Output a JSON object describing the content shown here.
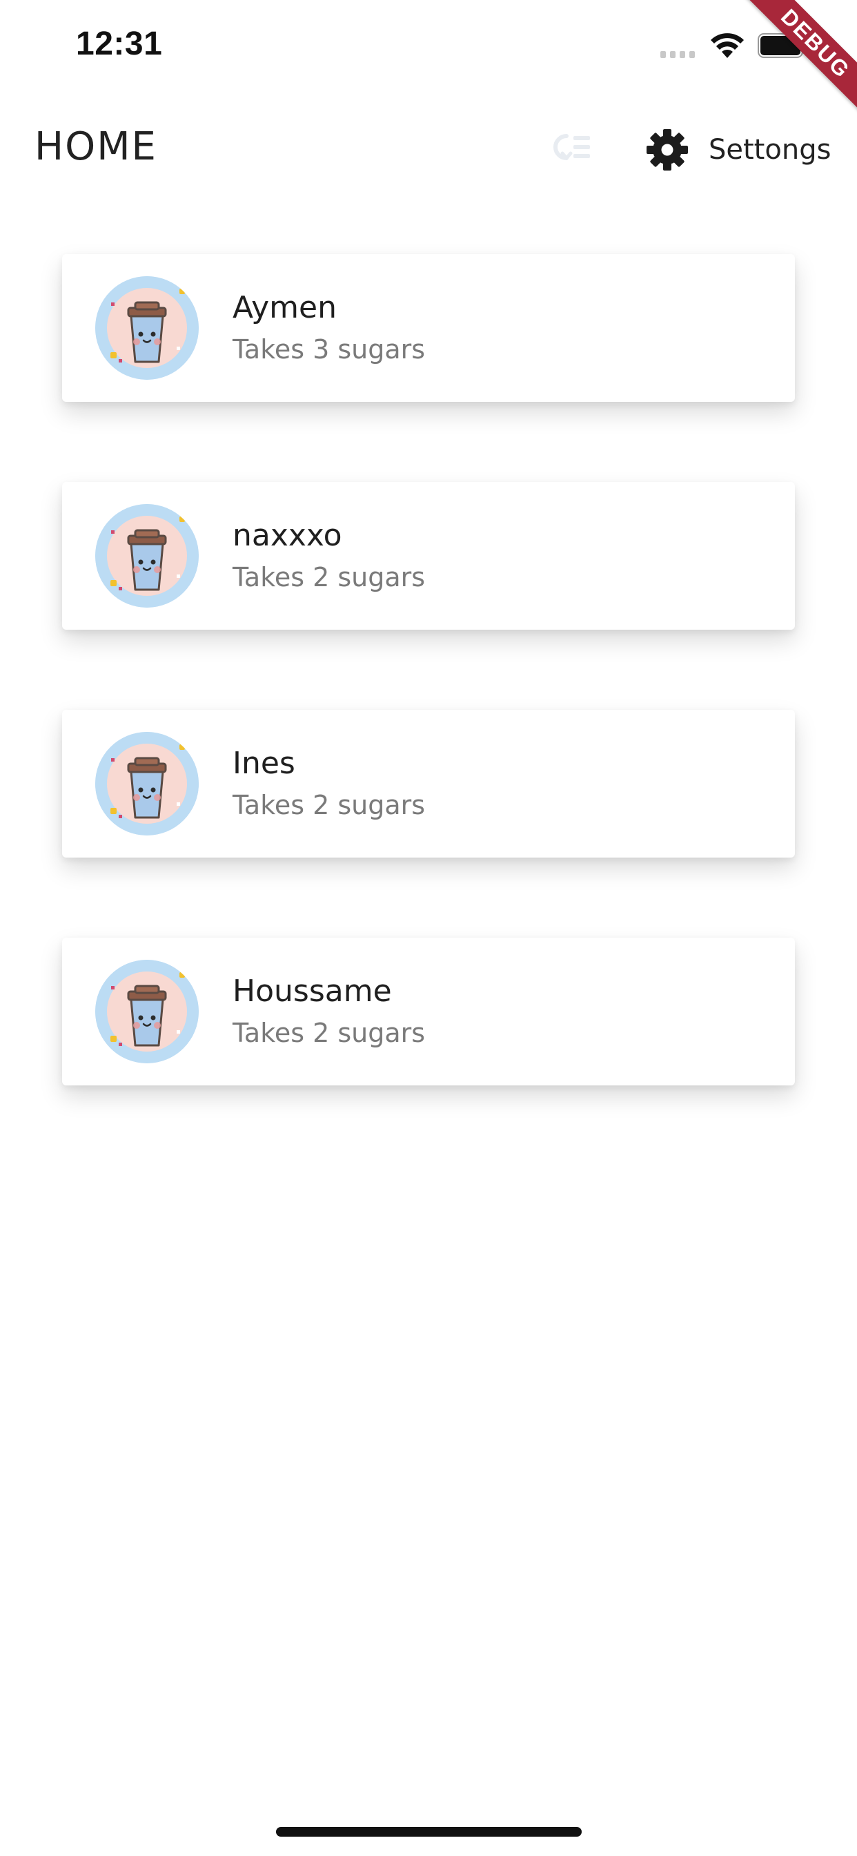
{
  "status_bar": {
    "time": "12:31"
  },
  "debug_banner": "DEBUG",
  "app_bar": {
    "title": "HOME",
    "filter_icon": "filter-list-icon",
    "settings_label": "Settongs",
    "settings_icon": "gear-icon"
  },
  "cards": [
    {
      "name": "Aymen",
      "subtitle": "Takes 3 sugars",
      "avatar_icon": "coffee-cup-icon"
    },
    {
      "name": "naxxxo",
      "subtitle": "Takes 2 sugars",
      "avatar_icon": "coffee-cup-icon"
    },
    {
      "name": "Ines",
      "subtitle": "Takes 2 sugars",
      "avatar_icon": "coffee-cup-icon"
    },
    {
      "name": "Houssame",
      "subtitle": "Takes 2 sugars",
      "avatar_icon": "coffee-cup-icon"
    }
  ],
  "colors": {
    "card_background": "#ffffff",
    "subtitle_text": "#7a7a7a",
    "avatar_ring": "#bcdcf4",
    "avatar_inner": "#f8d9d2",
    "debug_banner": "#a8273a"
  }
}
